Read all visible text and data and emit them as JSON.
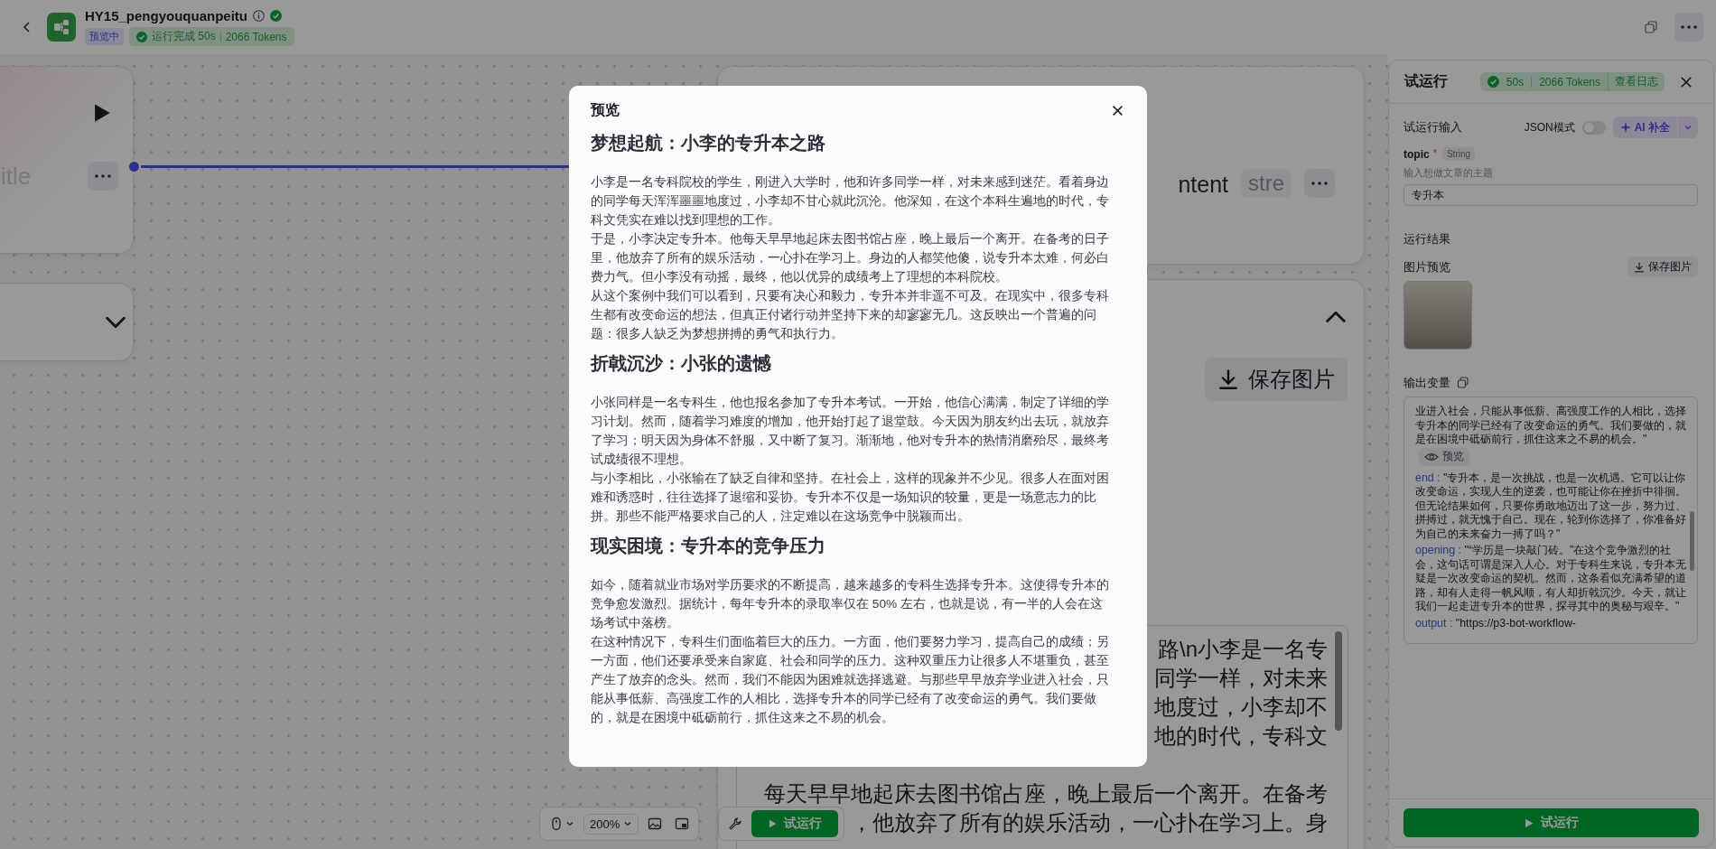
{
  "top_bar": {
    "title": "HY15_pengyouquanpeitu",
    "badge": "预览中",
    "run_status": "运行完成 50s",
    "tokens": "2066 Tokens"
  },
  "canvas": {
    "start_node": {
      "title": "itle"
    },
    "content_node": {
      "title": "ntent",
      "tag": "stre"
    },
    "collapsed_node": {
      "expanded": false
    },
    "result_node": {
      "expanded": true,
      "save_button": "保存图片",
      "text_lines": [
        "路\\n小李是一名专",
        "同学一样，对未来",
        "地度过，小李却不",
        "地的时代，专科文",
        "每天早早地起床去图书馆占座，晚上最后一个离开。在备考",
        "，他放弃了所有的娱乐活动，一心扑在学习上。身"
      ]
    },
    "toolbar": {
      "zoom": "200%",
      "run_button": "试运行"
    }
  },
  "modal": {
    "title": "预览",
    "sections": [
      {
        "heading": "梦想起航：小李的专升本之路",
        "paragraphs": [
          "小李是一名专科院校的学生，刚进入大学时，他和许多同学一样，对未来感到迷茫。看着身边的同学每天浑浑噩噩地度过，小李却不甘心就此沉沦。他深知，在这个本科生遍地的时代，专科文凭实在难以找到理想的工作。",
          "于是，小李决定专升本。他每天早早地起床去图书馆占座，晚上最后一个离开。在备考的日子里，他放弃了所有的娱乐活动，一心扑在学习上。身边的人都笑他傻，说专升本太难，何必白费力气。但小李没有动摇，最终，他以优异的成绩考上了理想的本科院校。",
          "从这个案例中我们可以看到，只要有决心和毅力，专升本并非遥不可及。在现实中，很多专科生都有改变命运的想法，但真正付诸行动并坚持下来的却寥寥无几。这反映出一个普遍的问题：很多人缺乏为梦想拼搏的勇气和执行力。"
        ]
      },
      {
        "heading": "折戟沉沙：小张的遗憾",
        "paragraphs": [
          "小张同样是一名专科生，他也报名参加了专升本考试。一开始，他信心满满，制定了详细的学习计划。然而，随着学习难度的增加，他开始打起了退堂鼓。今天因为朋友约出去玩，就放弃了学习；明天因为身体不舒服，又中断了复习。渐渐地，他对专升本的热情消磨殆尽，最终考试成绩很不理想。",
          "与小李相比，小张输在了缺乏自律和坚持。在社会上，这样的现象并不少见。很多人在面对困难和诱惑时，往往选择了退缩和妥协。专升本不仅是一场知识的较量，更是一场意志力的比拼。那些不能严格要求自己的人，注定难以在这场竞争中脱颖而出。"
        ]
      },
      {
        "heading": "现实困境：专升本的竞争压力",
        "paragraphs": [
          "如今，随着就业市场对学历要求的不断提高，越来越多的专科生选择专升本。这使得专升本的竞争愈发激烈。据统计，每年专升本的录取率仅在 50% 左右，也就是说，有一半的人会在这场考试中落榜。",
          "在这种情况下，专科生们面临着巨大的压力。一方面，他们要努力学习，提高自己的成绩；另一方面，他们还要承受来自家庭、社会和同学的压力。这种双重压力让很多人不堪重负，甚至产生了放弃的念头。然而，我们不能因为困难就选择逃避。与那些早早放弃学业进入社会，只能从事低薪、高强度工作的人相比，选择专升本的同学已经有了改变命运的勇气。我们要做的，就是在困境中砥砺前行，抓住这来之不易的机会。"
        ]
      }
    ]
  },
  "test_panel": {
    "title": "试运行",
    "status": {
      "time": "50s",
      "tokens": "2066 Tokens",
      "log_link": "查看日志"
    },
    "input_title": "试运行输入",
    "json_mode": {
      "label": "JSON模式",
      "on": false
    },
    "ai_button": "AI 补全",
    "params": [
      {
        "name": "topic",
        "required_mark": "*",
        "type": "String",
        "description": "输入想做文章的主题",
        "value": "专升本"
      }
    ],
    "result_title": "运行结果",
    "image_preview": {
      "label": "图片预览",
      "save_button": "保存图片"
    },
    "output": {
      "label": "输出变量",
      "items": [
        {
          "kind": "text",
          "text": "业进入社会，只能从事低薪、高强度工作的人相比，选择专升本的同学已经有了改变命运的勇气。我们要做的，就是在困境中砥砺前行，抓住这来之不易的机会。\""
        },
        {
          "kind": "preview",
          "text": "预览"
        },
        {
          "kind": "field",
          "key": "end :",
          "text": "\"专升本，是一次挑战，也是一次机遇。它可以让你改变命运，实现人生的逆袭，也可能让你在挫折中徘徊。但无论结果如何，只要你勇敢地迈出了这一步，努力过、拼搏过，就无愧于自己。现在，轮到你选择了，你准备好为自己的未来奋力一搏了吗？\""
        },
        {
          "kind": "field",
          "key": "opening :",
          "text": "\"“学历是一块敲门砖。”在这个竞争激烈的社会，这句话可谓是深入人心。对于专科生来说，专升本无疑是一次改变命运的契机。然而，这条看似充满希望的道路，却有人走得一帆风顺，有人却折戟沉沙。今天，就让我们一起走进专升本的世界，探寻其中的奥秘与艰辛。\""
        },
        {
          "kind": "field",
          "key": "output :",
          "text": "\"https://p3-bot-workflow-"
        }
      ]
    },
    "run_button": "试运行"
  }
}
